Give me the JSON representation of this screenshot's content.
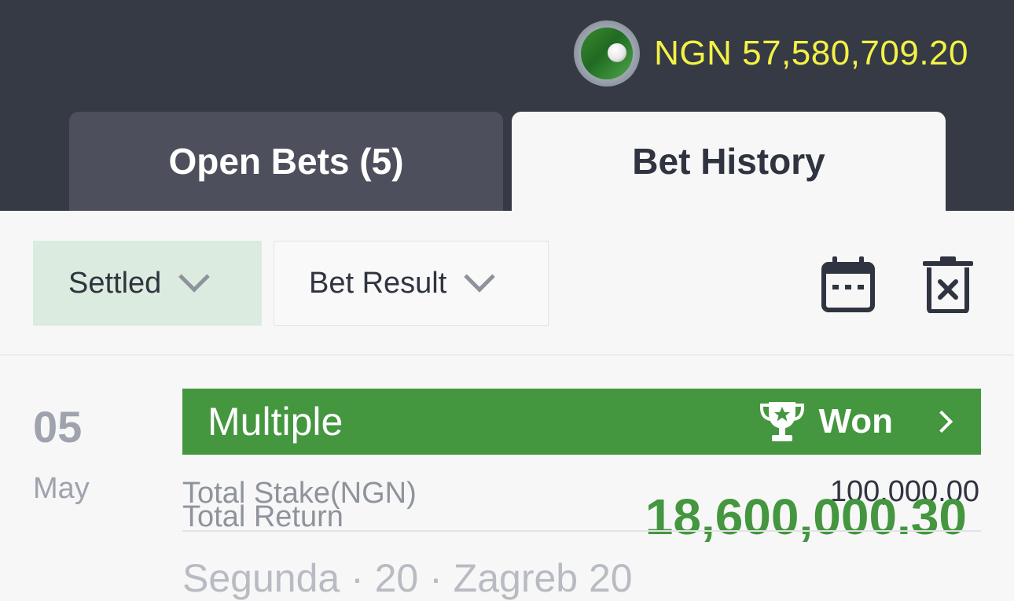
{
  "header": {
    "balance": "NGN 57,580,709.20",
    "avatar_icon": "golf-ball-avatar-icon",
    "balance_color": "#f3f245"
  },
  "tabs": [
    {
      "label": "Open Bets (5)",
      "active": false
    },
    {
      "label": "Bet History",
      "active": true
    }
  ],
  "filters": {
    "status_label": "Settled",
    "result_label": "Bet Result",
    "calendar_icon": "calendar-icon",
    "clear_icon": "trash-clear-icon"
  },
  "bet": {
    "day": "05",
    "month": "May",
    "type": "Multiple",
    "result": "Won",
    "result_icon": "trophy-icon",
    "stake_label": "Total Stake(NGN)",
    "stake_value": "100,000.00",
    "return_label": "Total Return",
    "return_value": "18,600,000.30",
    "partial_text": "Segunda · 20 · Zagreb 20",
    "accent_color": "#44963f"
  }
}
